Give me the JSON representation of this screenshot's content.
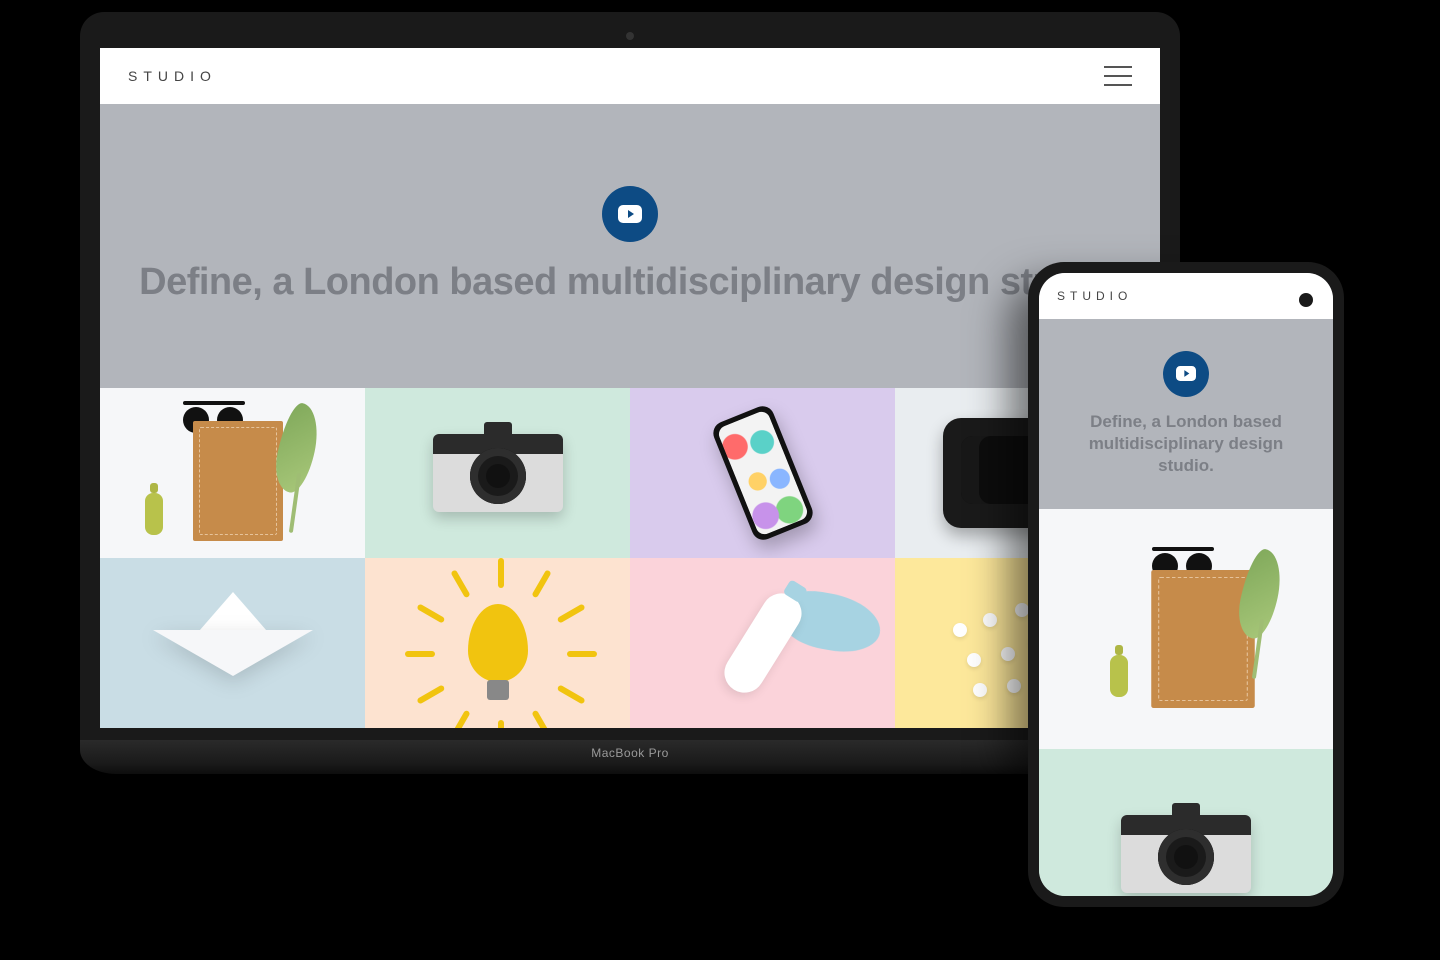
{
  "brand": "STUDIO",
  "device_label": "MacBook Pro",
  "hero": {
    "headline": "Define, a London based multidisciplinary design studio.",
    "play_icon": "play-icon"
  },
  "menu_icon": "hamburger-icon",
  "tiles": [
    {
      "name": "flatlay-stationery",
      "bg": "t-white"
    },
    {
      "name": "vintage-camera",
      "bg": "t-mint"
    },
    {
      "name": "smartphone",
      "bg": "t-lilac"
    },
    {
      "name": "vr-headset",
      "bg": "t-grey"
    },
    {
      "name": "paper-boat",
      "bg": "t-blue"
    },
    {
      "name": "lemon-lightbulb",
      "bg": "t-peach"
    },
    {
      "name": "paint-tube",
      "bg": "t-pink"
    },
    {
      "name": "pills-scatter",
      "bg": "t-yellow"
    }
  ],
  "mobile": {
    "headline": "Define, a London based multidisciplinary design studio."
  }
}
